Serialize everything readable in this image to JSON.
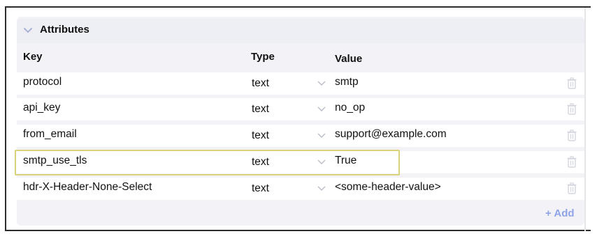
{
  "section": {
    "title": "Attributes"
  },
  "columns": {
    "key": "Key",
    "type": "Type",
    "value": "Value"
  },
  "rows": [
    {
      "key": "protocol",
      "type": "text",
      "value": "smtp"
    },
    {
      "key": "api_key",
      "type": "text",
      "value": "no_op"
    },
    {
      "key": "from_email",
      "type": "text",
      "value": "support@example.com"
    },
    {
      "key": "smtp_use_tls",
      "type": "text",
      "value": "True"
    },
    {
      "key": "hdr-X-Header-None-Select",
      "type": "text",
      "value": "<some-header-value>"
    }
  ],
  "actions": {
    "add_label": "+ Add"
  },
  "icons": {
    "collapse": "chevron-down-icon",
    "delete": "trash-icon",
    "select": "chevron-down-icon"
  },
  "colors": {
    "accent": "#8fa3e8",
    "highlight": "#d9d27a",
    "panel": "#f3f3f7"
  }
}
